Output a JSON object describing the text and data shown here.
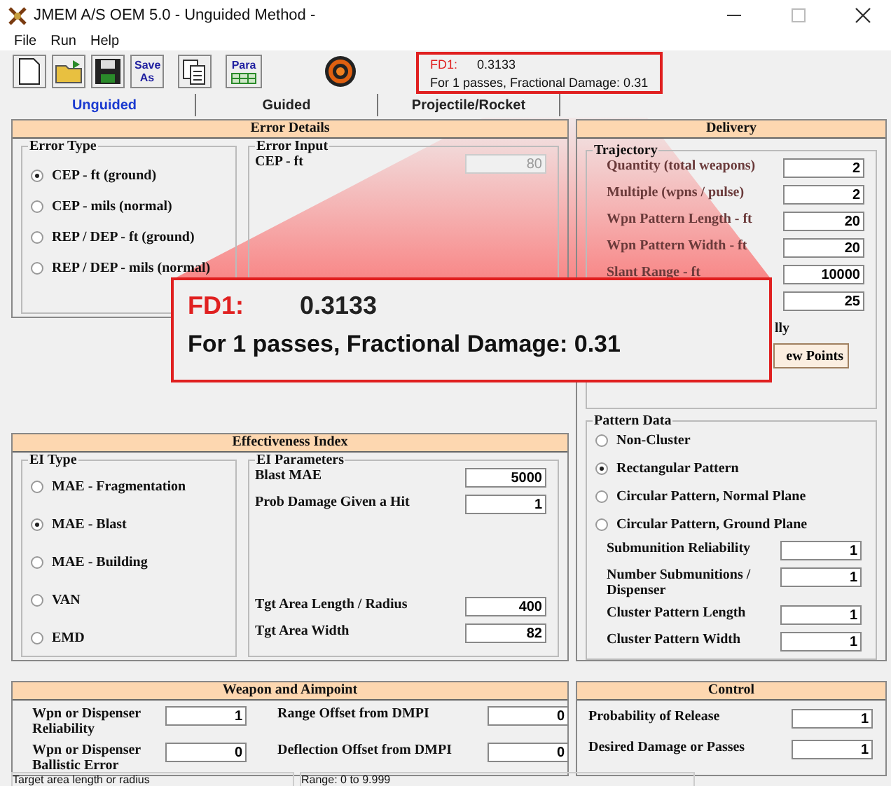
{
  "window": {
    "title": "JMEM A/S OEM 5.0 - Unguided Method -"
  },
  "menu": [
    "File",
    "Run",
    "Help"
  ],
  "toolbar": [
    {
      "kind": "new"
    },
    {
      "kind": "open"
    },
    {
      "kind": "save"
    },
    {
      "kind": "save-as",
      "label": "Save As"
    },
    {
      "kind": "copy"
    },
    {
      "kind": "para",
      "label": "Para"
    },
    {
      "kind": "target"
    }
  ],
  "result": {
    "label": "FD1:",
    "value": "0.3133",
    "summary": "For 1 passes, Fractional Damage: 0.31"
  },
  "tabs": [
    {
      "label": "Unguided",
      "selected": true
    },
    {
      "label": "Guided",
      "selected": false
    },
    {
      "label": "Projectile/Rocket",
      "selected": false
    }
  ],
  "error_details": {
    "title": "Error Details",
    "error_type": {
      "title": "Error Type",
      "options": [
        {
          "label": "CEP - ft (ground)",
          "selected": true
        },
        {
          "label": "CEP - mils (normal)",
          "selected": false
        },
        {
          "label": "REP / DEP - ft (ground)",
          "selected": false
        },
        {
          "label": "REP / DEP - mils (normal)",
          "selected": false
        }
      ]
    },
    "error_input": {
      "title": "Error Input",
      "fields": [
        {
          "label": "CEP - ft",
          "value": "80",
          "disabled": true
        }
      ]
    }
  },
  "delivery": {
    "title": "Delivery",
    "trajectory": {
      "title": "Trajectory",
      "fields": [
        {
          "label": "Quantity (total weapons)",
          "value": "2"
        },
        {
          "label": "Multiple (wpns / pulse)",
          "value": "2"
        },
        {
          "label": "Wpn Pattern Length - ft",
          "value": "20"
        },
        {
          "label": "Wpn Pattern Width - ft",
          "value": "20"
        },
        {
          "label": "Slant Range - ft",
          "value": "10000"
        },
        {
          "value": "25"
        }
      ],
      "option_fragment": "lly",
      "button_fragment": "ew Points"
    },
    "pattern_data": {
      "title": "Pattern Data",
      "options": [
        {
          "label": "Non-Cluster",
          "selected": false
        },
        {
          "label": "Rectangular Pattern",
          "selected": true
        },
        {
          "label": "Circular Pattern, Normal Plane",
          "selected": false
        },
        {
          "label": "Circular Pattern, Ground Plane",
          "selected": false
        }
      ],
      "fields": [
        {
          "label": "Submunition Reliability",
          "value": "1"
        },
        {
          "label": "Number Submunitions / Dispenser",
          "value": "1"
        },
        {
          "label": "Cluster Pattern Length",
          "value": "1"
        },
        {
          "label": "Cluster Pattern Width",
          "value": "1"
        }
      ]
    }
  },
  "effectiveness_index": {
    "title": "Effectiveness Index",
    "ei_type": {
      "title": "EI Type",
      "options": [
        {
          "label": "MAE - Fragmentation",
          "selected": false
        },
        {
          "label": "MAE - Blast",
          "selected": true
        },
        {
          "label": "MAE - Building",
          "selected": false
        },
        {
          "label": "VAN",
          "selected": false
        },
        {
          "label": "EMD",
          "selected": false
        }
      ]
    },
    "ei_parameters": {
      "title": "EI Parameters",
      "fields": [
        {
          "label": "Blast MAE",
          "value": "5000"
        },
        {
          "label": "Prob Damage Given a Hit",
          "value": "1"
        }
      ],
      "area_fields": [
        {
          "label": "Tgt Area Length / Radius",
          "value": "400"
        },
        {
          "label": "Tgt Area Width",
          "value": "82"
        }
      ]
    }
  },
  "weapon_aimpoint": {
    "title": "Weapon and Aimpoint",
    "fields": [
      {
        "label": "Wpn or Dispenser Reliability",
        "value": "1"
      },
      {
        "label": "Range Offset from DMPI",
        "value": "0"
      },
      {
        "label": "Wpn or Dispenser Ballistic Error",
        "value": "0"
      },
      {
        "label": "Deflection Offset from DMPI",
        "value": "0"
      }
    ]
  },
  "control": {
    "title": "Control",
    "fields": [
      {
        "label": "Probability of Release",
        "value": "1"
      },
      {
        "label": "Desired Damage or Passes",
        "value": "1"
      }
    ]
  },
  "status_bar": [
    "Target area length or radius",
    "Range:  0 to 9.999"
  ],
  "zoom_callout": {
    "label": "FD1:",
    "value": "0.3133",
    "summary": "For 1 passes, Fractional Damage: 0.31"
  }
}
